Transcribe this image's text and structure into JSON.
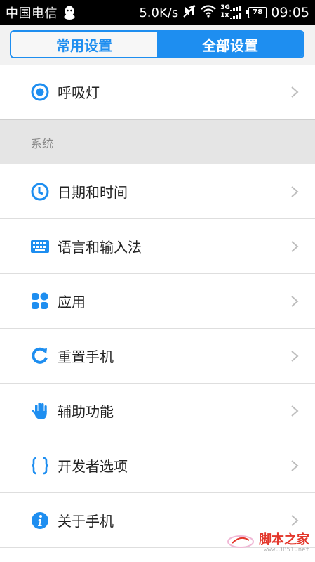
{
  "status_bar": {
    "carrier": "中国电信",
    "network_speed": "5.0K/s",
    "signal_label_top": "3G",
    "signal_label_bottom": "1x",
    "battery": "78",
    "time": "09:05",
    "icons": [
      "qq-icon",
      "mute-icon",
      "wifi-icon",
      "signal-icon",
      "battery-icon"
    ]
  },
  "tabs": [
    {
      "label": "常用设置",
      "active": false
    },
    {
      "label": "全部设置",
      "active": true
    }
  ],
  "top_item": {
    "label": "呼吸灯",
    "icon": "breathing-light-icon"
  },
  "section": {
    "title": "系统"
  },
  "items": [
    {
      "label": "日期和时间",
      "icon": "clock-icon"
    },
    {
      "label": "语言和输入法",
      "icon": "keyboard-icon"
    },
    {
      "label": "应用",
      "icon": "apps-grid-icon"
    },
    {
      "label": "重置手机",
      "icon": "reset-icon"
    },
    {
      "label": "辅助功能",
      "icon": "hand-icon"
    },
    {
      "label": "开发者选项",
      "icon": "braces-icon"
    },
    {
      "label": "关于手机",
      "icon": "info-icon"
    }
  ],
  "watermark": {
    "brand": "脚本之家",
    "url": "www.JB51.net"
  },
  "colors": {
    "accent": "#1e8ef0",
    "status_bar": "#000000",
    "section_bg": "#e5e5e5"
  }
}
